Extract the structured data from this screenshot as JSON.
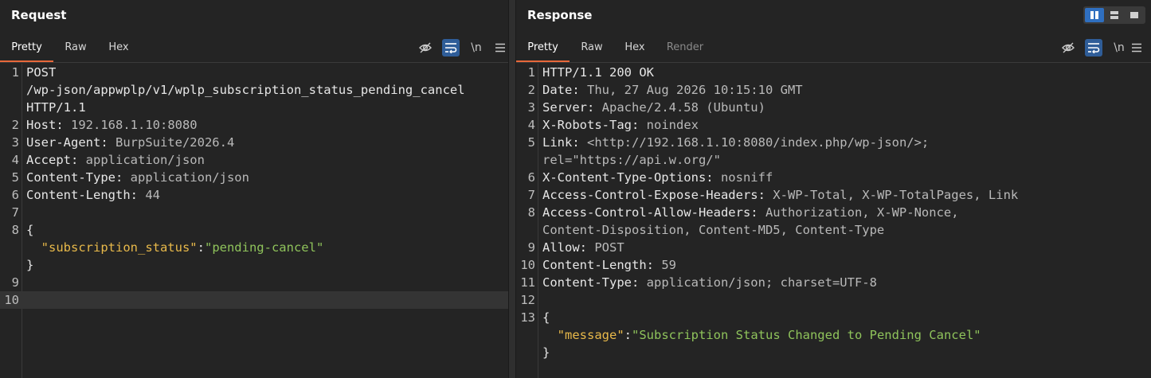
{
  "request": {
    "title": "Request",
    "tabs": [
      "Pretty",
      "Raw",
      "Hex"
    ],
    "active_tab": "Pretty",
    "lines": [
      {
        "n": "1",
        "parts": [
          {
            "t": "POST",
            "c": "k"
          }
        ]
      },
      {
        "n": "",
        "parts": [
          {
            "t": "/wp-json/appwplp/v1/wplp_subscription_status_pending_cancel",
            "c": "k"
          }
        ]
      },
      {
        "n": "",
        "parts": [
          {
            "t": "HTTP/1.1",
            "c": "k"
          }
        ]
      },
      {
        "n": "2",
        "parts": [
          {
            "t": "Host:",
            "c": "k"
          },
          {
            "t": " 192.168.1.10:8080",
            "c": "v"
          }
        ]
      },
      {
        "n": "3",
        "parts": [
          {
            "t": "User-Agent:",
            "c": "k"
          },
          {
            "t": " BurpSuite/2026.4",
            "c": "v"
          }
        ]
      },
      {
        "n": "4",
        "parts": [
          {
            "t": "Accept:",
            "c": "k"
          },
          {
            "t": " application/json",
            "c": "v"
          }
        ]
      },
      {
        "n": "5",
        "parts": [
          {
            "t": "Content-Type:",
            "c": "k"
          },
          {
            "t": " application/json",
            "c": "v"
          }
        ]
      },
      {
        "n": "6",
        "parts": [
          {
            "t": "Content-Length:",
            "c": "k"
          },
          {
            "t": " 44",
            "c": "v"
          }
        ]
      },
      {
        "n": "7",
        "parts": []
      },
      {
        "n": "8",
        "parts": [
          {
            "t": "{",
            "c": "k"
          }
        ]
      },
      {
        "n": "",
        "parts": [
          {
            "t": "  ",
            "c": "k"
          },
          {
            "t": "\"subscription_status\"",
            "c": "jk"
          },
          {
            "t": ":",
            "c": "k"
          },
          {
            "t": "\"pending-cancel\"",
            "c": "js"
          }
        ]
      },
      {
        "n": "",
        "parts": [
          {
            "t": "}",
            "c": "k"
          }
        ]
      },
      {
        "n": "9",
        "parts": []
      },
      {
        "n": "10",
        "parts": [],
        "highlight": true
      }
    ]
  },
  "response": {
    "title": "Response",
    "tabs": [
      "Pretty",
      "Raw",
      "Hex",
      "Render"
    ],
    "active_tab": "Pretty",
    "lines": [
      {
        "n": "1",
        "parts": [
          {
            "t": "HTTP/1.1 200 OK",
            "c": "k"
          }
        ]
      },
      {
        "n": "2",
        "parts": [
          {
            "t": "Date:",
            "c": "k"
          },
          {
            "t": " Thu, 27 Aug 2026 10:15:10 GMT",
            "c": "v"
          }
        ]
      },
      {
        "n": "3",
        "parts": [
          {
            "t": "Server:",
            "c": "k"
          },
          {
            "t": " Apache/2.4.58 (Ubuntu)",
            "c": "v"
          }
        ]
      },
      {
        "n": "4",
        "parts": [
          {
            "t": "X-Robots-Tag:",
            "c": "k"
          },
          {
            "t": " noindex",
            "c": "v"
          }
        ]
      },
      {
        "n": "5",
        "parts": [
          {
            "t": "Link:",
            "c": "k"
          },
          {
            "t": " <http://192.168.1.10:8080/index.php/wp-json/>;",
            "c": "v"
          }
        ]
      },
      {
        "n": "",
        "parts": [
          {
            "t": "rel=\"https://api.w.org/\"",
            "c": "v"
          }
        ]
      },
      {
        "n": "6",
        "parts": [
          {
            "t": "X-Content-Type-Options:",
            "c": "k"
          },
          {
            "t": " nosniff",
            "c": "v"
          }
        ]
      },
      {
        "n": "7",
        "parts": [
          {
            "t": "Access-Control-Expose-Headers:",
            "c": "k"
          },
          {
            "t": " X-WP-Total, X-WP-TotalPages, Link",
            "c": "v"
          }
        ]
      },
      {
        "n": "8",
        "parts": [
          {
            "t": "Access-Control-Allow-Headers:",
            "c": "k"
          },
          {
            "t": " Authorization, X-WP-Nonce,",
            "c": "v"
          }
        ]
      },
      {
        "n": "",
        "parts": [
          {
            "t": "Content-Disposition, Content-MD5, Content-Type",
            "c": "v"
          }
        ]
      },
      {
        "n": "9",
        "parts": [
          {
            "t": "Allow:",
            "c": "k"
          },
          {
            "t": " POST",
            "c": "v"
          }
        ]
      },
      {
        "n": "10",
        "parts": [
          {
            "t": "Content-Length:",
            "c": "k"
          },
          {
            "t": " 59",
            "c": "v"
          }
        ]
      },
      {
        "n": "11",
        "parts": [
          {
            "t": "Content-Type:",
            "c": "k"
          },
          {
            "t": " application/json; charset=UTF-8",
            "c": "v"
          }
        ]
      },
      {
        "n": "12",
        "parts": []
      },
      {
        "n": "13",
        "parts": [
          {
            "t": "{",
            "c": "k"
          }
        ]
      },
      {
        "n": "",
        "parts": [
          {
            "t": "  ",
            "c": "k"
          },
          {
            "t": "\"message\"",
            "c": "jk"
          },
          {
            "t": ":",
            "c": "k"
          },
          {
            "t": "\"Subscription Status Changed to Pending Cancel\"",
            "c": "js"
          }
        ]
      },
      {
        "n": "",
        "parts": [
          {
            "t": "}",
            "c": "k"
          }
        ]
      }
    ]
  },
  "toolbar": {
    "newline_label": "\\n",
    "icons": [
      "eye-off-icon",
      "wrap-icon",
      "newline-icon",
      "menu-icon"
    ]
  },
  "colors": {
    "accent": "#e8683a",
    "selected": "#2f6fc0",
    "json_key": "#e8b94a",
    "json_string": "#8fc35b"
  }
}
